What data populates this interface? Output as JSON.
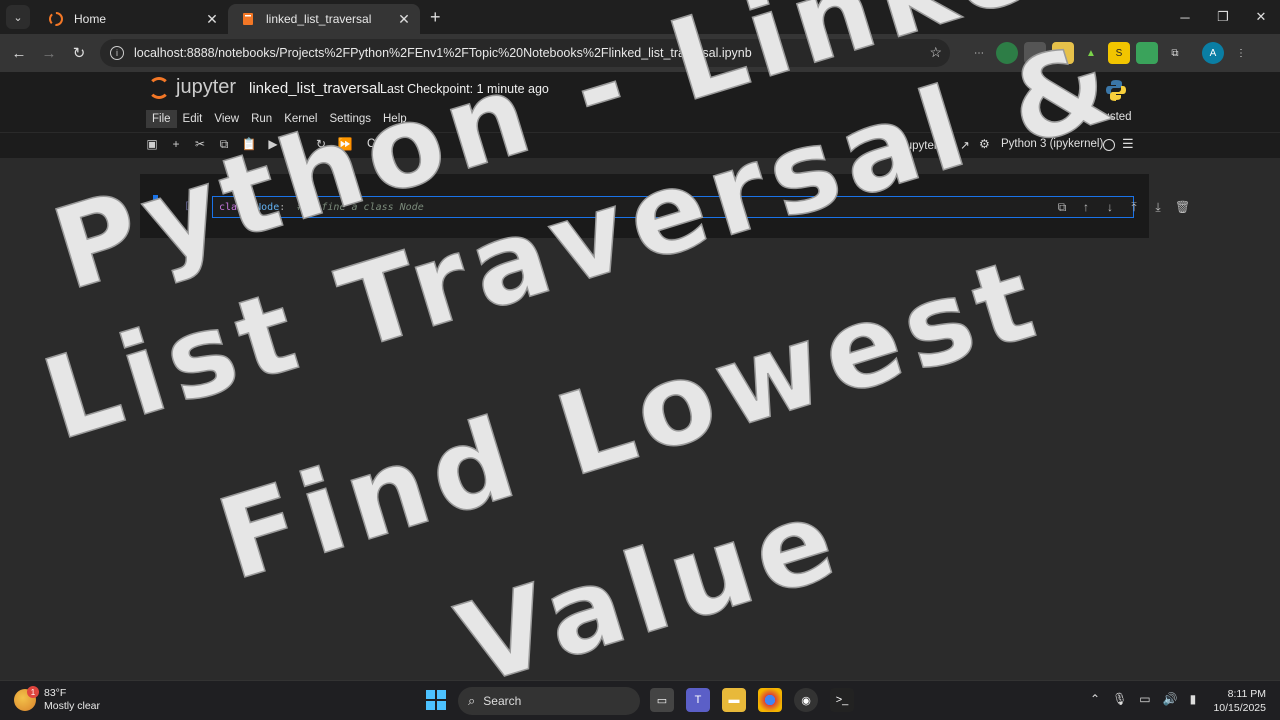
{
  "browser": {
    "tabs": [
      {
        "title": "Home",
        "active": false
      },
      {
        "title": "linked_list_traversal",
        "active": true
      }
    ],
    "url": "localhost:8888/notebooks/Projects%2FPython%2FEnv1%2FTopic%20Notebooks%2Flinked_list_traversal.ipynb",
    "profile_initial": "A"
  },
  "jupyter": {
    "logo_text": "jupyter",
    "notebook_title": "linked_list_traversal",
    "checkpoint": "Last Checkpoint: 1 minute ago",
    "menu": [
      "File",
      "Edit",
      "View",
      "Run",
      "Kernel",
      "Settings",
      "Help"
    ],
    "trusted": "Trusted",
    "cell_type": "Code",
    "jupyterlab_link": "JupyterLab",
    "kernel_name": "Python 3 (ipykernel)"
  },
  "cell": {
    "prompt": "[ ]:",
    "code_keyword": "class",
    "code_class": "Node",
    "code_comment": "# Define a class Node"
  },
  "overlay_text": {
    "line1": "Python - Linked",
    "line2": "List Traversal &",
    "line3": "Find Lowest",
    "line4": "Value"
  },
  "taskbar": {
    "weather_badge": "1",
    "temperature": "83°F",
    "condition": "Mostly clear",
    "search_label": "Search",
    "time": "8:11 PM",
    "date": "10/15/2025"
  },
  "colors": {
    "accent": "#1a73e8",
    "jupyter_orange": "#f37726",
    "overlay_text": "#e6e6e6"
  }
}
